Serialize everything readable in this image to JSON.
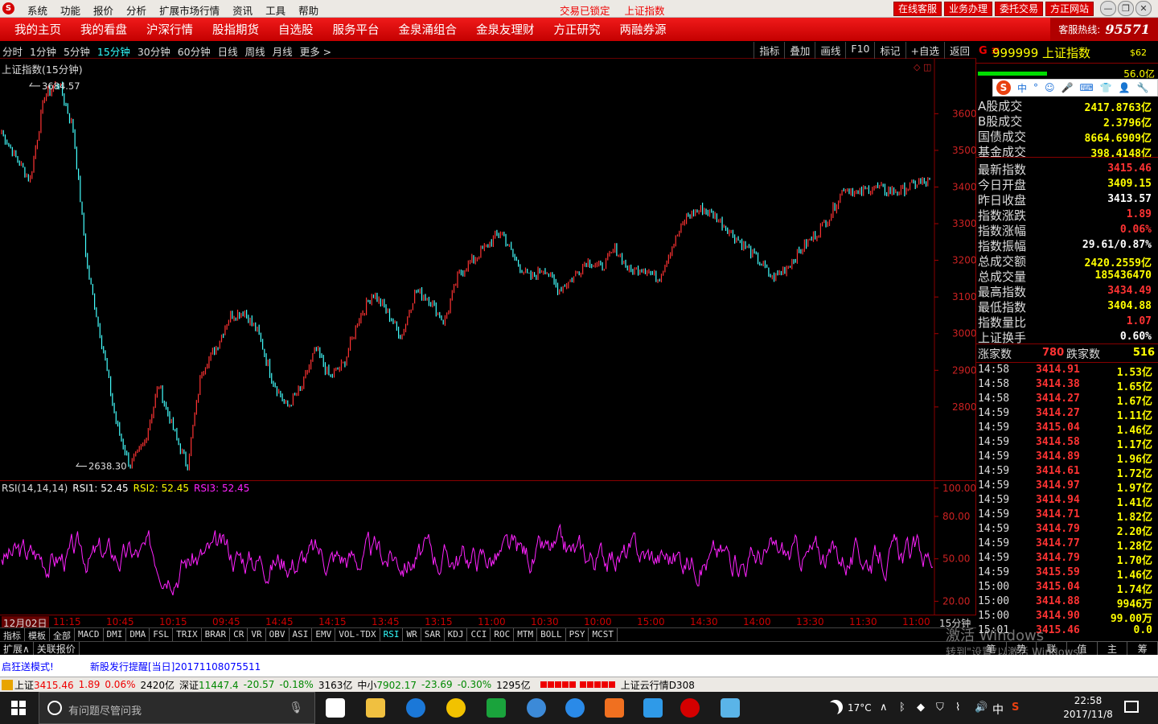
{
  "titlebar": {
    "menus": [
      "系统",
      "功能",
      "报价",
      "分析",
      "扩展市场行情",
      "资讯",
      "工具",
      "帮助"
    ],
    "status": [
      "交易已锁定",
      "上证指数"
    ],
    "quick_buttons": [
      "在线客服",
      "业务办理",
      "委托交易",
      "方正网站"
    ]
  },
  "navbar": {
    "items": [
      "我的主页",
      "我的看盘",
      "沪深行情",
      "股指期货",
      "自选股",
      "服务平台",
      "金泉涌组合",
      "金泉友理财",
      "方正研究",
      "两融券源"
    ],
    "hotline_label": "客服热线:",
    "hotline_number": "95571"
  },
  "period_bar": {
    "periods": [
      "分时",
      "1分钟",
      "5分钟",
      "15分钟",
      "30分钟",
      "60分钟",
      "日线",
      "周线",
      "月线",
      "更多 >"
    ],
    "active": 3,
    "tools": [
      "指标",
      "叠加",
      "画线",
      "F10",
      "标记",
      "+自选",
      "返回"
    ]
  },
  "main_chart": {
    "title": "上证指数(15分钟)",
    "high_label": "3684.57",
    "low_label": "2638.30",
    "y_ticks": [
      "3600",
      "3500",
      "3400",
      "3300",
      "3200",
      "3100",
      "3000",
      "2900",
      "2800"
    ],
    "y_values": [
      3600,
      3500,
      3400,
      3300,
      3200,
      3100,
      3000,
      2900,
      2800
    ],
    "colors": {
      "up": "#ff3333",
      "down": "#44ffff",
      "rsi": "#ff22ff"
    }
  },
  "chart_data": [
    {
      "type": "line",
      "title": "上证指数(15分钟)",
      "series": [
        {
          "name": "上证指数",
          "values": [
            3550,
            3480,
            3420,
            3650,
            3684,
            3560,
            3180,
            2980,
            2760,
            2640,
            2700,
            2860,
            2740,
            2638,
            2900,
            2960,
            3050,
            3060,
            3000,
            2870,
            2800,
            2850,
            2960,
            2880,
            2920,
            3040,
            3110,
            3060,
            2990,
            3120,
            3090,
            3030,
            3160,
            3200,
            3240,
            3280,
            3200,
            3150,
            3180,
            3120,
            3150,
            3200,
            3180,
            3230,
            3170,
            3180,
            3150,
            3240,
            3320,
            3340,
            3320,
            3280,
            3240,
            3200,
            3150,
            3180,
            3230,
            3270,
            3320,
            3400,
            3380,
            3400,
            3390,
            3390,
            3410,
            3415
          ]
        }
      ],
      "ylim": [
        2600,
        3750
      ],
      "labels": {
        "high": 3684.57,
        "low": 2638.3
      }
    },
    {
      "type": "line",
      "title": "RSI(14,14,14)",
      "series": [
        {
          "name": "RSI1",
          "values": [
            52.45
          ]
        },
        {
          "name": "RSI2",
          "values": [
            52.45
          ]
        },
        {
          "name": "RSI3",
          "values": [
            52.45
          ]
        }
      ],
      "ylim": [
        10,
        105
      ],
      "y_ticks": [
        100,
        80,
        50,
        20
      ]
    }
  ],
  "rsi": {
    "legend": "RSI(14,14,14)",
    "rsi1": "RSI1: 52.45",
    "rsi2": "RSI2: 52.45",
    "rsi3": "RSI3: 52.45",
    "y_ticks": [
      "100.00",
      "80.00",
      "50.00",
      "20.00"
    ]
  },
  "time_axis": {
    "labels": [
      "12月02日",
      "11:15",
      "10:45",
      "10:15",
      "09:45",
      "14:45",
      "14:15",
      "13:45",
      "13:15",
      "11:00",
      "10:30",
      "10:00",
      "15:00",
      "14:30",
      "14:00",
      "13:30",
      "11:30",
      "11:00"
    ],
    "unit": "15分钟"
  },
  "indicator_tabs": [
    "指标",
    "模板",
    "全部",
    "MACD",
    "DMI",
    "DMA",
    "FSL",
    "TRIX",
    "BRAR",
    "CR",
    "VR",
    "OBV",
    "ASI",
    "EMV",
    "VOL-TDX",
    "RSI",
    "WR",
    "SAR",
    "KDJ",
    "CCI",
    "ROC",
    "MTM",
    "BOLL",
    "PSY",
    "MCST"
  ],
  "indicator_active": "RSI",
  "sub_tabs": [
    "扩展∧",
    "关联报价"
  ],
  "right_panel": {
    "g": "G ≡",
    "code_name": "999999 上证指数",
    "s62": "$62",
    "bar_value": "56.0亿",
    "ime": [
      "中",
      "°",
      "☺",
      "🎤",
      "⌨",
      "👕",
      "👤",
      "🔧"
    ],
    "stats": [
      {
        "k": "A股成交",
        "v": "2417.8763亿",
        "c": "#ff0"
      },
      {
        "k": "B股成交",
        "v": "2.3796亿",
        "c": "#ff0"
      },
      {
        "k": "国债成交",
        "v": "8664.6909亿",
        "c": "#ff0"
      },
      {
        "k": "基金成交",
        "v": "398.4148亿",
        "c": "#ff0"
      },
      {
        "k": "最新指数",
        "v": "3415.46",
        "c": "#f33"
      },
      {
        "k": "今日开盘",
        "v": "3409.15",
        "c": "#ff0"
      },
      {
        "k": "昨日收盘",
        "v": "3413.57",
        "c": "#fff"
      },
      {
        "k": "指数涨跌",
        "v": "1.89",
        "c": "#f33"
      },
      {
        "k": "指数涨幅",
        "v": "0.06%",
        "c": "#f33"
      },
      {
        "k": "指数振幅",
        "v": "29.61/0.87%",
        "c": "#fff"
      },
      {
        "k": "总成交额",
        "v": "2420.2559亿",
        "c": "#ff0"
      },
      {
        "k": "总成交量",
        "v": "185436470",
        "c": "#ff0"
      },
      {
        "k": "最高指数",
        "v": "3434.49",
        "c": "#f33"
      },
      {
        "k": "最低指数",
        "v": "3404.88",
        "c": "#ff0"
      },
      {
        "k": "指数量比",
        "v": "1.07",
        "c": "#f33"
      },
      {
        "k": "上证换手",
        "v": "0.60%",
        "c": "#fff"
      }
    ],
    "up_label": "涨家数",
    "up_value": "780",
    "down_label": "跌家数",
    "down_value": "516",
    "ticks": [
      [
        "14:58",
        "3414.91",
        "1.53亿"
      ],
      [
        "14:58",
        "3414.38",
        "1.65亿"
      ],
      [
        "14:58",
        "3414.27",
        "1.67亿"
      ],
      [
        "14:59",
        "3414.27",
        "1.11亿"
      ],
      [
        "14:59",
        "3415.04",
        "1.46亿"
      ],
      [
        "14:59",
        "3414.58",
        "1.17亿"
      ],
      [
        "14:59",
        "3414.89",
        "1.96亿"
      ],
      [
        "14:59",
        "3414.61",
        "1.72亿"
      ],
      [
        "14:59",
        "3414.97",
        "1.97亿"
      ],
      [
        "14:59",
        "3414.94",
        "1.41亿"
      ],
      [
        "14:59",
        "3414.71",
        "1.82亿"
      ],
      [
        "14:59",
        "3414.79",
        "2.20亿"
      ],
      [
        "14:59",
        "3414.77",
        "1.28亿"
      ],
      [
        "14:59",
        "3414.79",
        "1.70亿"
      ],
      [
        "14:59",
        "3415.59",
        "1.46亿"
      ],
      [
        "15:00",
        "3415.04",
        "1.74亿"
      ],
      [
        "15:00",
        "3414.88",
        "9946万"
      ],
      [
        "15:00",
        "3414.90",
        "99.00万"
      ],
      [
        "15:01",
        "3415.46",
        "0.0"
      ]
    ],
    "tabs": [
      "笔",
      "势",
      "联",
      "值",
      "主",
      "筹"
    ],
    "activate_line1": "激活 Windows",
    "activate_line2": "转到\"设置\"以激活 Windows。"
  },
  "ticker": {
    "mode": "启狂送模式!",
    "news": "新股发行提醒[当日]20171108075511"
  },
  "statusbar": {
    "sh_name": "上证",
    "sh_price": "3415.46",
    "sh_chg": "1.89",
    "sh_pct": "0.06%",
    "sh_amt": "2420亿",
    "sz_name": "深证",
    "sz_price": "11447.4",
    "sz_chg": "-20.57",
    "sz_pct": "-0.18%",
    "sz_amt": "3163亿",
    "zx_name": "中小",
    "zx_price": "7902.17",
    "zx_chg": "-23.69",
    "zx_pct": "-0.30%",
    "zx_amt": "1295亿",
    "cloud": "上证云行情D308"
  },
  "taskbar": {
    "search_placeholder": "有问题尽管问我",
    "temperature": "17°C",
    "ime": "中",
    "time": "22:58",
    "date": "2017/11/8"
  }
}
